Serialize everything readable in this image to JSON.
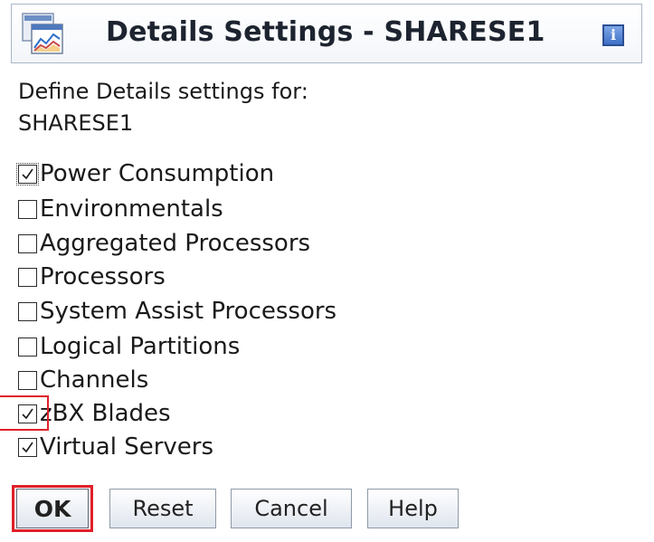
{
  "dialog": {
    "title": "Details Settings - SHARESE1",
    "info_icon_glyph": "i"
  },
  "intro": {
    "line1": "Define Details settings for:",
    "line2": "SHARESE1"
  },
  "options": [
    {
      "label": "Power Consumption",
      "checked": true
    },
    {
      "label": "Environmentals",
      "checked": false
    },
    {
      "label": "Aggregated Processors",
      "checked": false
    },
    {
      "label": "Processors",
      "checked": false
    },
    {
      "label": "System Assist Processors",
      "checked": false
    },
    {
      "label": "Logical Partitions",
      "checked": false
    },
    {
      "label": "Channels",
      "checked": false
    },
    {
      "label": "zBX Blades",
      "checked": true
    },
    {
      "label": "Virtual Servers",
      "checked": true
    }
  ],
  "buttons": {
    "ok": "OK",
    "reset": "Reset",
    "cancel": "Cancel",
    "help": "Help"
  },
  "colors": {
    "highlight": "#e0202a",
    "info_button": "#3d6fc7"
  }
}
